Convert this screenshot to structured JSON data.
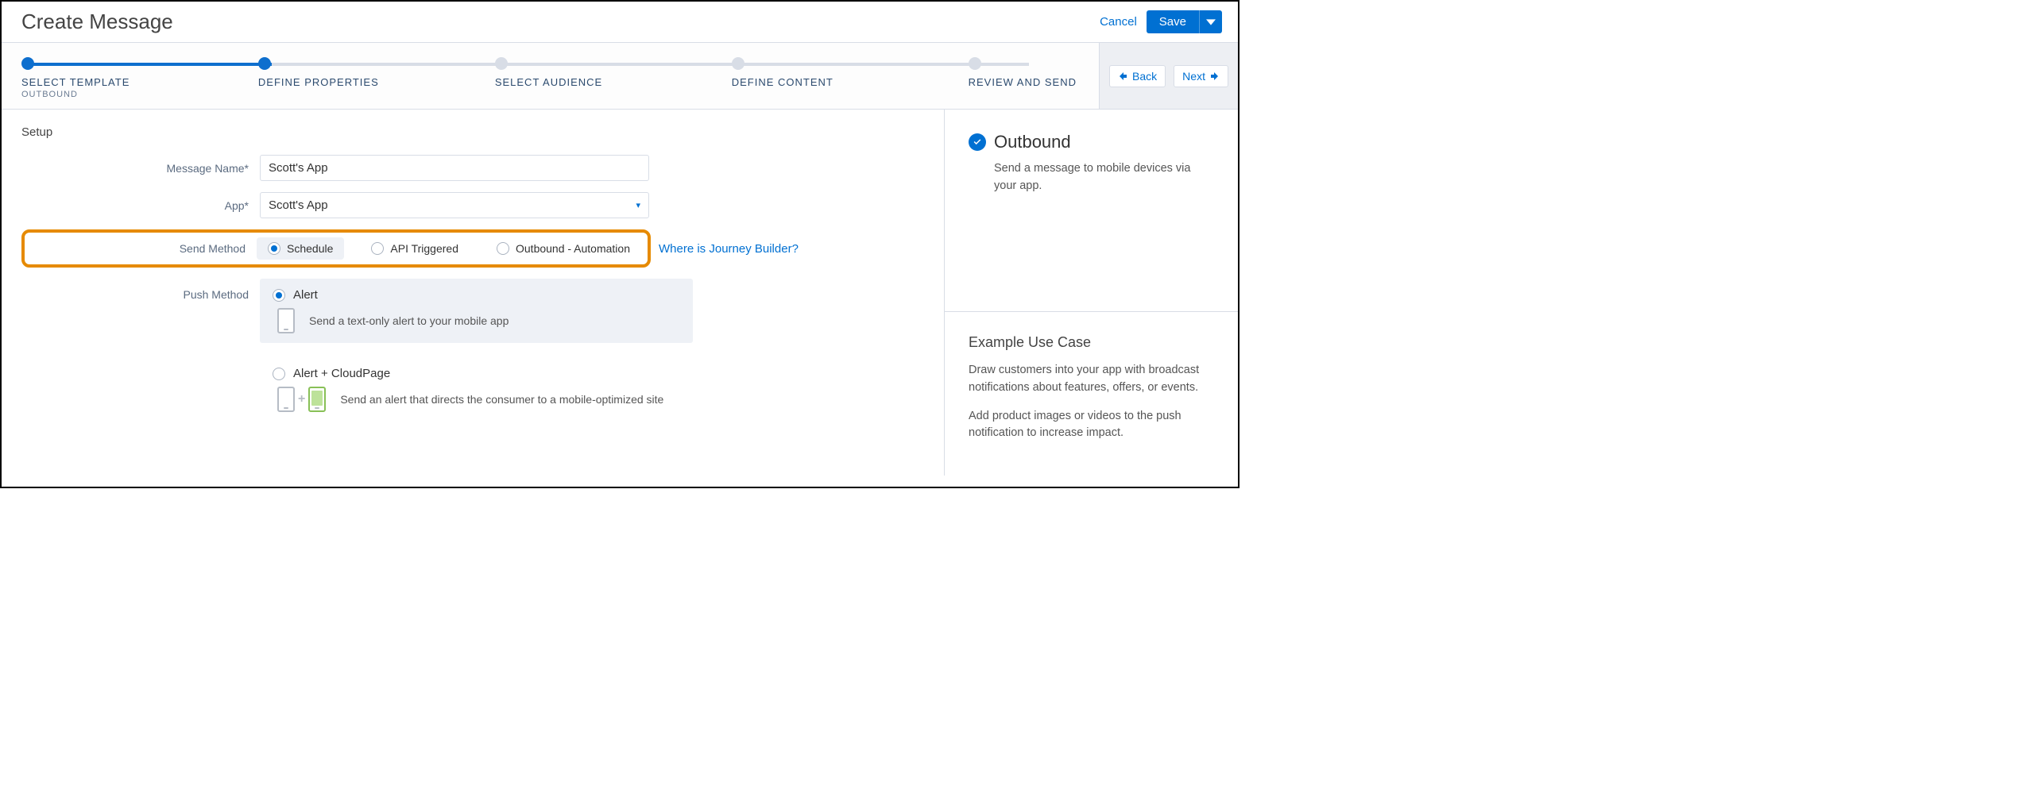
{
  "header": {
    "title": "Create Message",
    "cancel": "Cancel",
    "save": "Save"
  },
  "wizard": {
    "steps": [
      {
        "label": "SELECT TEMPLATE",
        "sublabel": "OUTBOUND",
        "state": "done"
      },
      {
        "label": "DEFINE PROPERTIES",
        "state": "active"
      },
      {
        "label": "SELECT AUDIENCE",
        "state": "todo"
      },
      {
        "label": "DEFINE CONTENT",
        "state": "todo"
      },
      {
        "label": "REVIEW AND SEND",
        "state": "todo"
      }
    ],
    "back": "Back",
    "next": "Next"
  },
  "setup": {
    "heading": "Setup",
    "labels": {
      "messageName": "Message Name*",
      "app": "App*",
      "sendMethod": "Send Method",
      "pushMethod": "Push Method"
    },
    "messageNameValue": "Scott's App",
    "appValue": "Scott's App",
    "sendMethods": {
      "schedule": "Schedule",
      "apiTriggered": "API Triggered",
      "outboundAutomation": "Outbound - Automation"
    },
    "journeyBuilderLink": "Where is Journey Builder?",
    "pushMethods": {
      "alert": {
        "title": "Alert",
        "desc": "Send a text-only alert to your mobile app"
      },
      "alertCloudpage": {
        "title": "Alert + CloudPage",
        "desc": "Send an alert that directs the consumer to a mobile-optimized site"
      }
    }
  },
  "sidebar": {
    "outbound": {
      "title": "Outbound",
      "desc": "Send a message to mobile devices via your app."
    },
    "example": {
      "title": "Example Use Case",
      "p1": "Draw customers into your app with broadcast notifications about features, offers, or events.",
      "p2": "Add product images or videos to the push notification to increase impact."
    }
  }
}
